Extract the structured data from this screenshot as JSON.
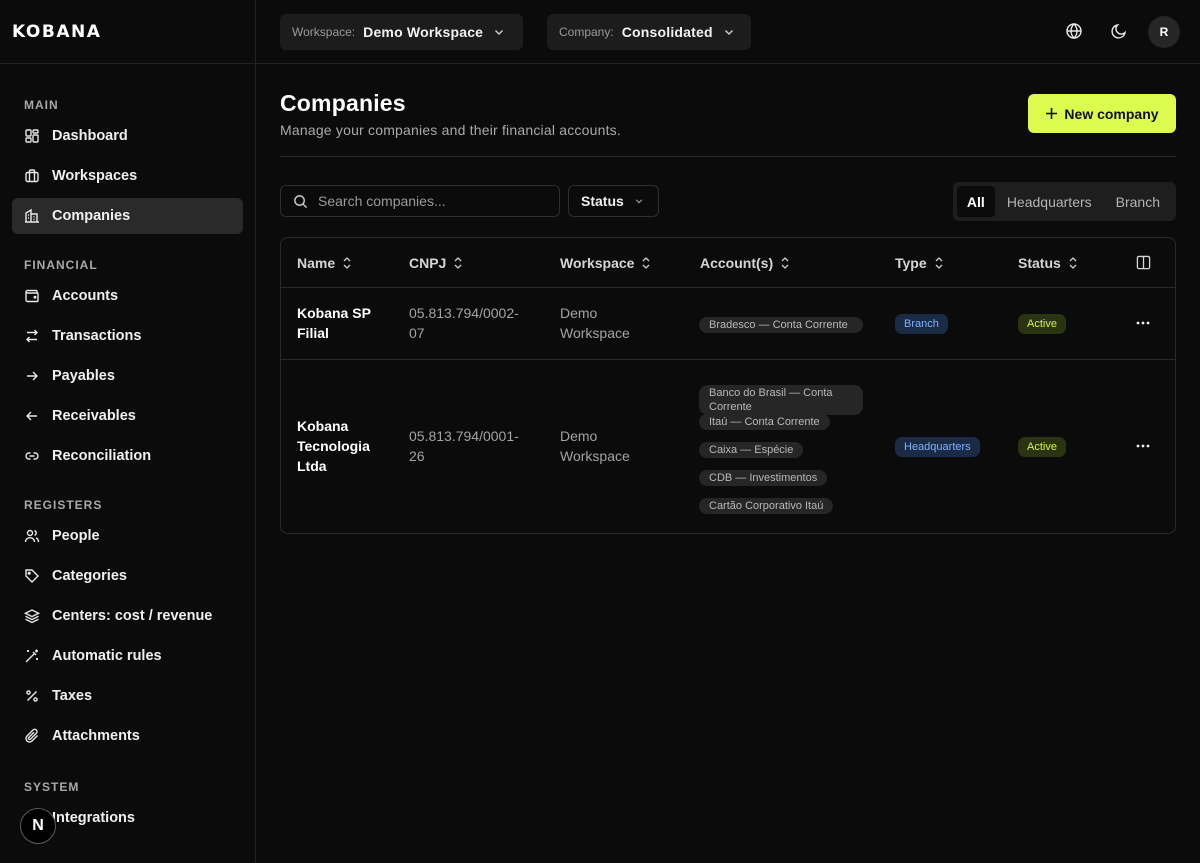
{
  "brand": {
    "logo": "KOBANA"
  },
  "topbar": {
    "workspace_label": "Workspace:",
    "workspace_value": "Demo Workspace",
    "company_label": "Company:",
    "company_value": "Consolidated",
    "avatar_initial": "R"
  },
  "sidebar": {
    "sections": [
      {
        "label": "MAIN",
        "items": [
          "Dashboard",
          "Workspaces",
          "Companies"
        ]
      },
      {
        "label": "FINANCIAL",
        "items": [
          "Accounts",
          "Transactions",
          "Payables",
          "Receivables",
          "Reconciliation"
        ]
      },
      {
        "label": "REGISTERS",
        "items": [
          "People",
          "Categories",
          "Centers: cost / revenue",
          "Automatic rules",
          "Taxes",
          "Attachments"
        ]
      },
      {
        "label": "SYSTEM",
        "items": [
          "Integrations"
        ]
      }
    ],
    "active_item": "Companies",
    "floating_badge": "N"
  },
  "page": {
    "title": "Companies",
    "subtitle": "Manage your companies and their financial accounts.",
    "new_button": "New company"
  },
  "filters": {
    "search_placeholder": "Search companies...",
    "status_label": "Status",
    "segments": [
      "All",
      "Headquarters",
      "Branch"
    ],
    "active_segment": "All"
  },
  "table": {
    "columns": [
      "Name",
      "CNPJ",
      "Workspace",
      "Account(s)",
      "Type",
      "Status"
    ],
    "rows": [
      {
        "name": "Kobana SP Filial",
        "cnpj": "05.813.794/0002-07",
        "workspace": "Demo Workspace",
        "accounts": [
          "Bradesco — Conta Corrente"
        ],
        "type": "Branch",
        "status": "Active"
      },
      {
        "name": "Kobana Tecnologia Ltda",
        "cnpj": "05.813.794/0001-26",
        "workspace": "Demo Workspace",
        "accounts": [
          "Banco do Brasil — Conta Corrente",
          "Itaú — Conta Corrente",
          "Caixa — Espécie",
          "CDB — Investimentos",
          "Cartão Corporativo Itaú"
        ],
        "type": "Headquarters",
        "status": "Active"
      }
    ]
  },
  "colors": {
    "accent": "#dcfb4e",
    "background": "#0b0b0b",
    "branch_badge": "#7eb1ff",
    "active_badge": "#d5f24b"
  }
}
